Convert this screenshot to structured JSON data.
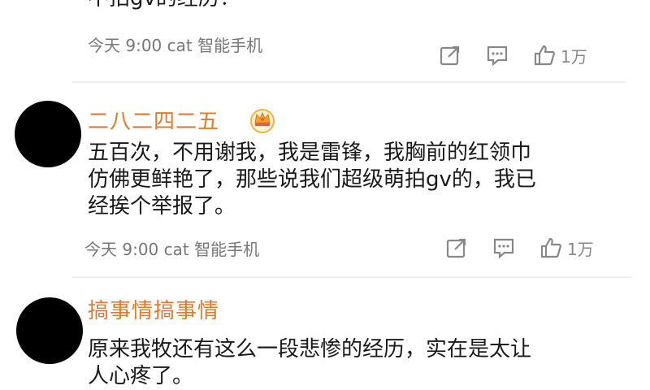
{
  "comments": [
    {
      "username": "",
      "text": "不拍gv的经历！",
      "meta": "今天 9:00 cat 智能手机",
      "likes": "1万"
    },
    {
      "username": "二八二四二五",
      "text": "五百次，不用谢我，我是雷锋，我胸前的红领巾\n仿佛更鲜艳了，那些说我们超级萌拍gv的，我已\n经挨个举报了。",
      "meta": "今天 9:00 cat 智能手机",
      "likes": "1万",
      "badge_icon": "crown-icon"
    },
    {
      "username": "搞事情搞事情",
      "text": "原来我牧还有这么一段悲惨的经历，实在是太让\n人心疼了。"
    }
  ],
  "icons": {
    "share": "share-icon",
    "comment": "comment-icon",
    "like": "thumbs-up-icon"
  },
  "colors": {
    "username": "#e07a2c",
    "meta": "#777777",
    "icon": "#888888"
  }
}
